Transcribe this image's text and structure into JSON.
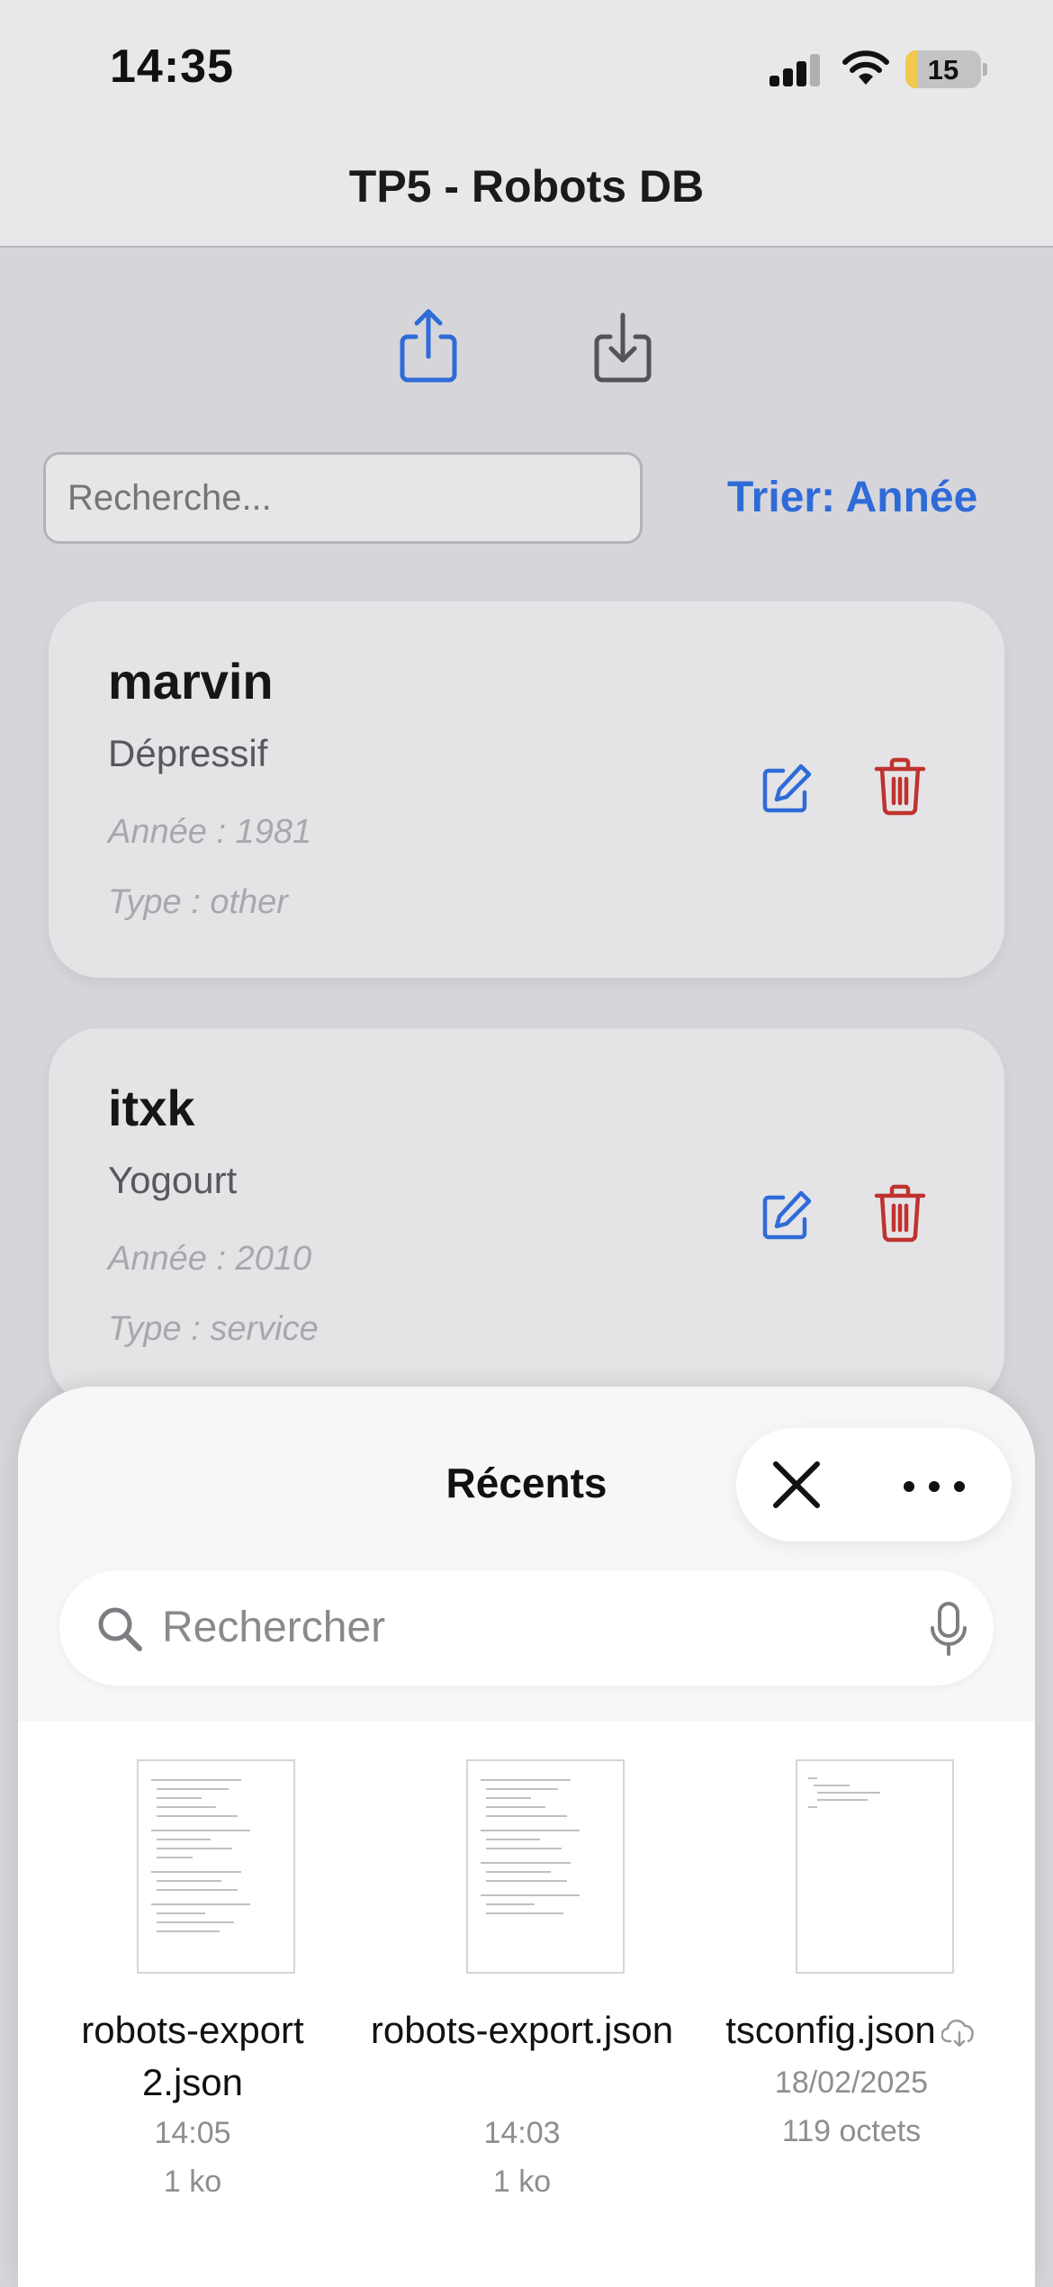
{
  "status": {
    "time": "14:35",
    "battery": "15",
    "battery_level": 0.15
  },
  "nav": {
    "title": "TP5 - Robots DB"
  },
  "toolbar": {
    "share_icon": "share-icon",
    "import_icon": "download-icon"
  },
  "search": {
    "placeholder": "Recherche..."
  },
  "sort": {
    "label": "Trier: Année"
  },
  "robots": [
    {
      "name": "marvin",
      "desc": "Dépressif",
      "year": "Année : 1981",
      "type": "Type : other"
    },
    {
      "name": "itxk",
      "desc": "Yogourt",
      "year": "Année : 2010",
      "type": "Type : service"
    }
  ],
  "colors": {
    "accent": "#2f6bd8",
    "danger": "#c0322f",
    "background": "#d6d6da"
  },
  "sheet": {
    "title": "Récents",
    "search_placeholder": "Rechercher",
    "files": [
      {
        "name": "robots-export 2.json",
        "date": "14:05",
        "size": "1 ko",
        "cloud": false
      },
      {
        "name": "robots-export.json",
        "date": "14:03",
        "size": "1 ko",
        "cloud": false
      },
      {
        "name": "tsconfig.json",
        "date": "18/02/2025",
        "size": "119 octets",
        "cloud": true
      }
    ]
  }
}
